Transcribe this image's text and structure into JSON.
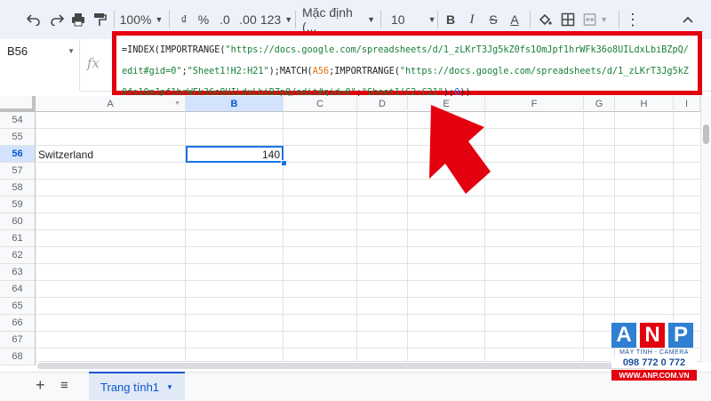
{
  "toolbar": {
    "zoom": "100%",
    "currency": "₫",
    "percent": "%",
    "decrease_decimal": ".0",
    "increase_decimal": ".00",
    "number_format": "123",
    "font_name": "Mặc định (...",
    "font_size": "10",
    "bold": "B",
    "strike": "S",
    "text_color": "A",
    "more": "⋮",
    "icons": [
      "undo-icon",
      "redo-icon",
      "print-icon",
      "paint-format-icon",
      "fill-color-icon",
      "borders-icon",
      "merge-icon",
      "more-icon"
    ]
  },
  "namebox": {
    "value": "B56"
  },
  "formula_bar": {
    "fx": "fx",
    "segments": [
      {
        "text": "=INDEX(IMPORTRANGE(",
        "kind": "p"
      },
      {
        "text": "\"https://docs.google.com/spreadsheets/d/1_zLKrT3Jg5kZ0fs1OmJpf1hrWFk36o8UILdxLbiBZpQ/edit#gid=0\"",
        "kind": "s"
      },
      {
        "text": ";",
        "kind": "p"
      },
      {
        "text": "\"Sheet1!H2:H21\"",
        "kind": "s"
      },
      {
        "text": ");MATCH(",
        "kind": "p"
      },
      {
        "text": "A56",
        "kind": "r"
      },
      {
        "text": ";IMPORTRANGE(",
        "kind": "p"
      },
      {
        "text": "\"https://docs.google.com/spreadsheets/d/1_zLKrT3Jg5kZ0fs1OmJpf1hrWFk36o8UILdxLbiBZpQ/edit#gid=0\"",
        "kind": "s"
      },
      {
        "text": ";",
        "kind": "p"
      },
      {
        "text": "\"Sheet1!C2:C21\"",
        "kind": "s"
      },
      {
        "text": ");",
        "kind": "p"
      },
      {
        "text": "0",
        "kind": "n"
      },
      {
        "text": "))",
        "kind": "p"
      }
    ]
  },
  "grid": {
    "columns": [
      "A",
      "B",
      "C",
      "D",
      "E",
      "F",
      "G",
      "H",
      "I"
    ],
    "selected_column": "B",
    "rows": [
      "54",
      "55",
      "56",
      "57",
      "58",
      "59",
      "60",
      "61",
      "62",
      "63",
      "64",
      "65",
      "66",
      "67",
      "68"
    ],
    "selected_row": "56",
    "cells": {
      "A56": "Switzerland",
      "B56": "140"
    }
  },
  "bottom": {
    "add": "+",
    "list": "≡",
    "sheet_tab": "Trang tính1"
  },
  "logo": {
    "letters": [
      "A",
      "N",
      "P"
    ],
    "tagline": "MÁY TÍNH - CAMERA",
    "phone": "098 772 0 772",
    "website": "WWW.ANP.COM.VN"
  },
  "colors": {
    "highlight_border": "#e3000f",
    "selection": "#1a73e8",
    "string": "#188038",
    "reference": "#e8710a",
    "number": "#1a73e8"
  }
}
